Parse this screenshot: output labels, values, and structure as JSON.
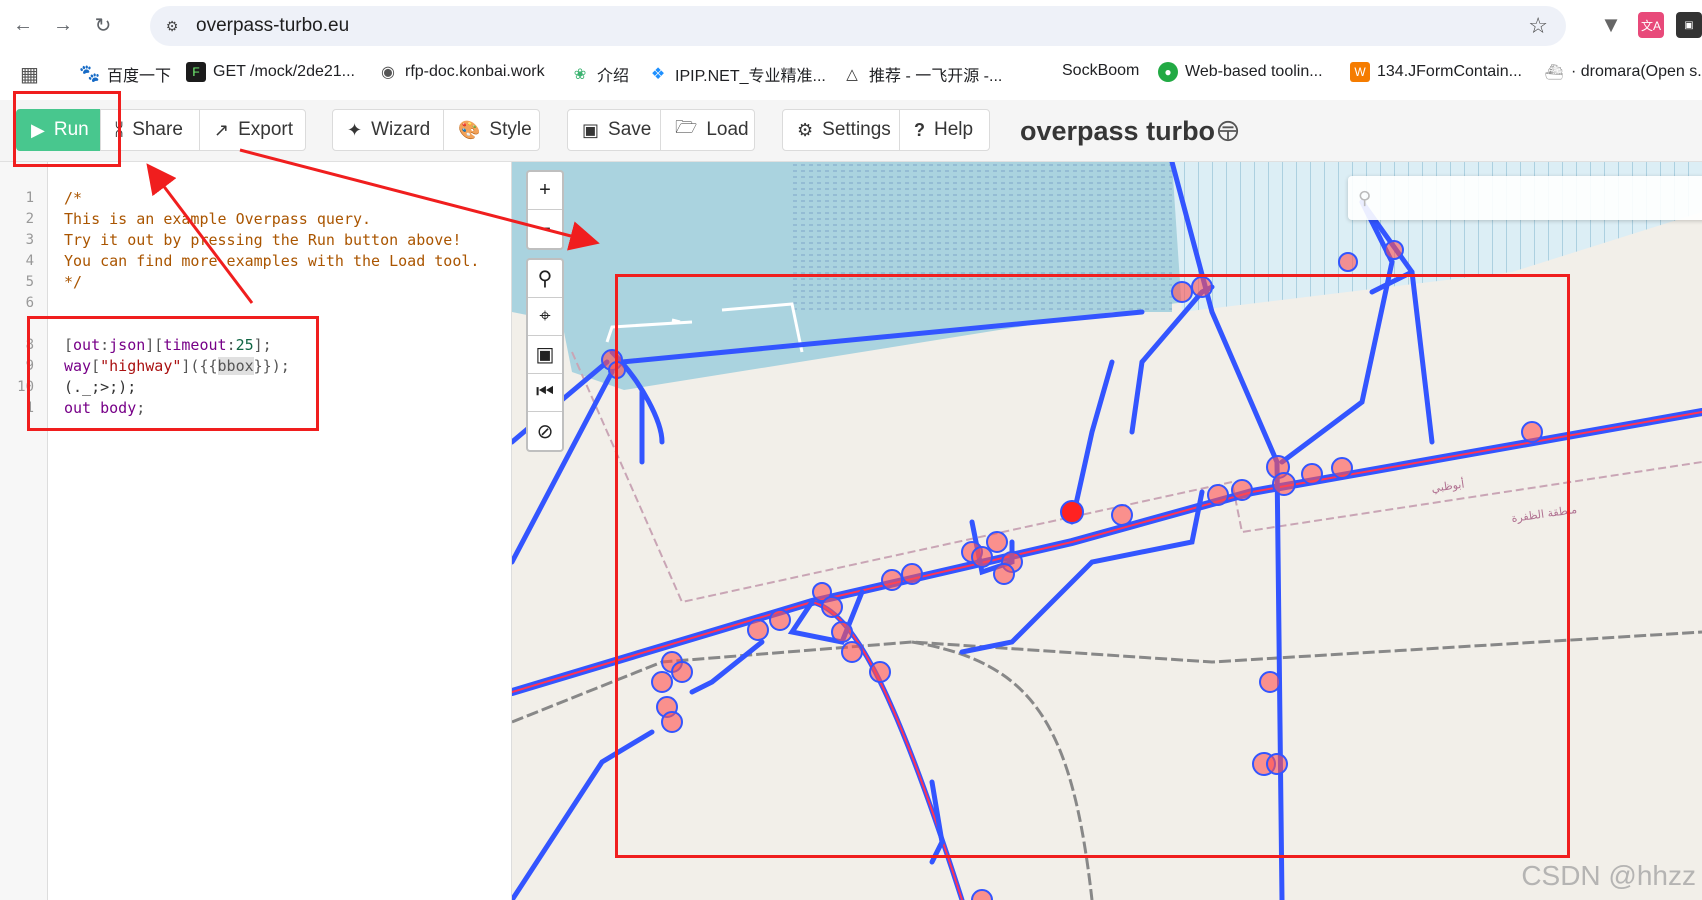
{
  "browser": {
    "url": "overpass-turbo.eu",
    "bookmarks": [
      {
        "label": "百度一下",
        "icon": "baidu-icon",
        "color": "#2932e1"
      },
      {
        "label": "GET /mock/2de21...",
        "icon": "terminal-icon",
        "color": "#1b1b1b"
      },
      {
        "label": "rfp-doc.konbai.work",
        "icon": "globe-icon",
        "color": "#555555"
      },
      {
        "label": "介绍",
        "icon": "leaf-icon",
        "color": "#3cb371"
      },
      {
        "label": "IPIP.NET_专业精准...",
        "icon": "ipip-icon",
        "color": "#1e90ff"
      },
      {
        "label": "推荐 - 一飞开源 -...",
        "icon": "triangle-icon",
        "color": "#333333"
      },
      {
        "label": "SockBoom",
        "icon": "",
        "color": ""
      },
      {
        "label": "Web-based toolin...",
        "icon": "bulb-icon",
        "color": "#22aa44"
      },
      {
        "label": "134.JFormContain...",
        "icon": "w-icon",
        "color": "#f57c00"
      },
      {
        "label": "· dromara(Open s...",
        "icon": "boat-icon",
        "color": "#999999"
      }
    ]
  },
  "toolbar": {
    "run": "Run",
    "share": "Share",
    "export": "Export",
    "wizard": "Wizard",
    "style": "Style",
    "save": "Save",
    "load": "Load",
    "settings": "Settings",
    "help": "Help",
    "brand": "overpass turbo"
  },
  "editor": {
    "line_numbers": [
      "1",
      "2",
      "3",
      "4",
      "5",
      "6",
      "",
      "8",
      "9",
      "10",
      "1"
    ],
    "comment": [
      "/*",
      "This is an example Overpass query.",
      "Try it out by pressing the Run button above!",
      "You can find more examples with the Load tool.",
      "*/"
    ],
    "query": {
      "l1_out": "out",
      "l1_json": "json",
      "l1_timeout": "timeout",
      "l1_num": "25",
      "l2_way": "way",
      "l2_str": "\"highway\"",
      "l2_bbox": "bbox",
      "l3": "(._;>;);",
      "l4_out": "out",
      "l4_body": "body"
    }
  },
  "map": {
    "search_placeholder": "",
    "controls": [
      "zoom-in",
      "zoom-out",
      "search",
      "locate",
      "image",
      "first",
      "clear"
    ],
    "colors": {
      "water": "#aad3df",
      "land": "#f2efe9",
      "way": "#3355ff",
      "node": "#ff3333"
    }
  },
  "watermark": "CSDN @hhzz",
  "colors": {
    "run": "#48c78e",
    "annotation": "#f01e1e"
  }
}
